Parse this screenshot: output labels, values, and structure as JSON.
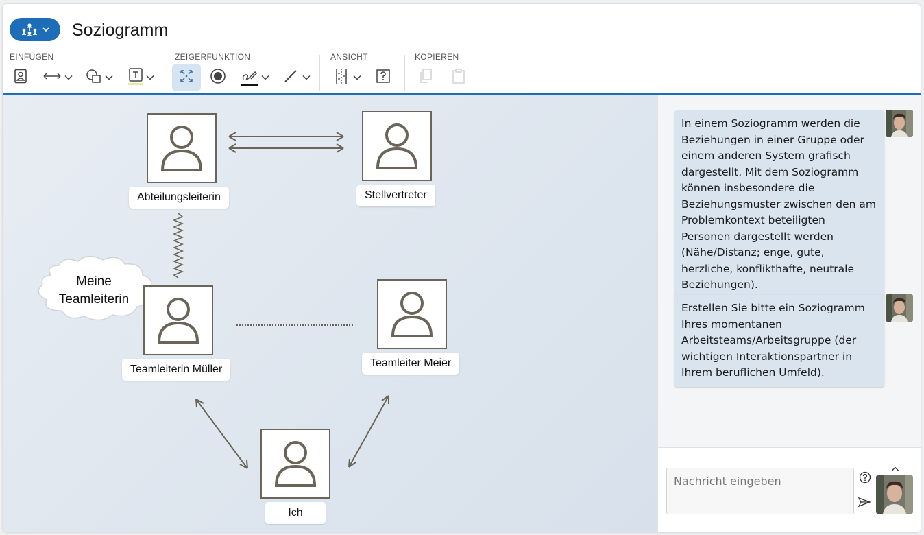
{
  "app": {
    "title": "Soziogramm"
  },
  "toolbar": {
    "groups": {
      "insert": "EINFÜGEN",
      "pointer": "ZEIGERFUNKTION",
      "view": "ANSICHT",
      "copy": "KOPIEREN"
    }
  },
  "diagram": {
    "persons": {
      "abteilungsleiterin": "Abteilungsleiterin",
      "stellvertreter": "Stellvertreter",
      "teamleiterin_mueller": "Teamleiterin Müller",
      "teamleiter_meier": "Teamleiter Meier",
      "ich": "Ich"
    },
    "cloud_line1": "Meine",
    "cloud_line2": "Teamleiterin"
  },
  "chat": {
    "messages": [
      {
        "text": "In einem Soziogramm werden die Beziehungen in einer Gruppe oder einem anderen System grafisch dargestellt. Mit dem Soziogramm können insbesondere die Beziehungsmuster zwischen den am Problemkontext beteiligten Personen dargestellt werden (Nähe/Distanz; enge, gute, herzliche, konflikthafte, neutrale Beziehungen)."
      },
      {
        "text": "Erstellen Sie bitte ein Soziogramm Ihres momentanen Arbeitsteams/Arbeitsgruppe (der wichtigen Interaktionspartner in Ihrem beruflichen Umfeld)."
      }
    ],
    "input_placeholder": "Nachricht eingeben"
  },
  "colors": {
    "accent": "#1e6db8",
    "person_border": "#6b6459",
    "bubble": "#d9e4ef"
  },
  "icons": {
    "mode": "org-chart-icon",
    "insert_person": "person-card-icon",
    "insert_arrow": "double-arrow-icon",
    "insert_shape": "shapes-icon",
    "insert_text": "text-box-icon",
    "pointer_select": "fit-expand-icon",
    "pointer_laser": "laser-dot-icon",
    "pointer_pen": "pen-icon",
    "pointer_line": "line-icon",
    "view_guides": "guides-icon",
    "view_help": "question-box-icon",
    "copy": "copy-icon",
    "paste": "paste-icon"
  }
}
